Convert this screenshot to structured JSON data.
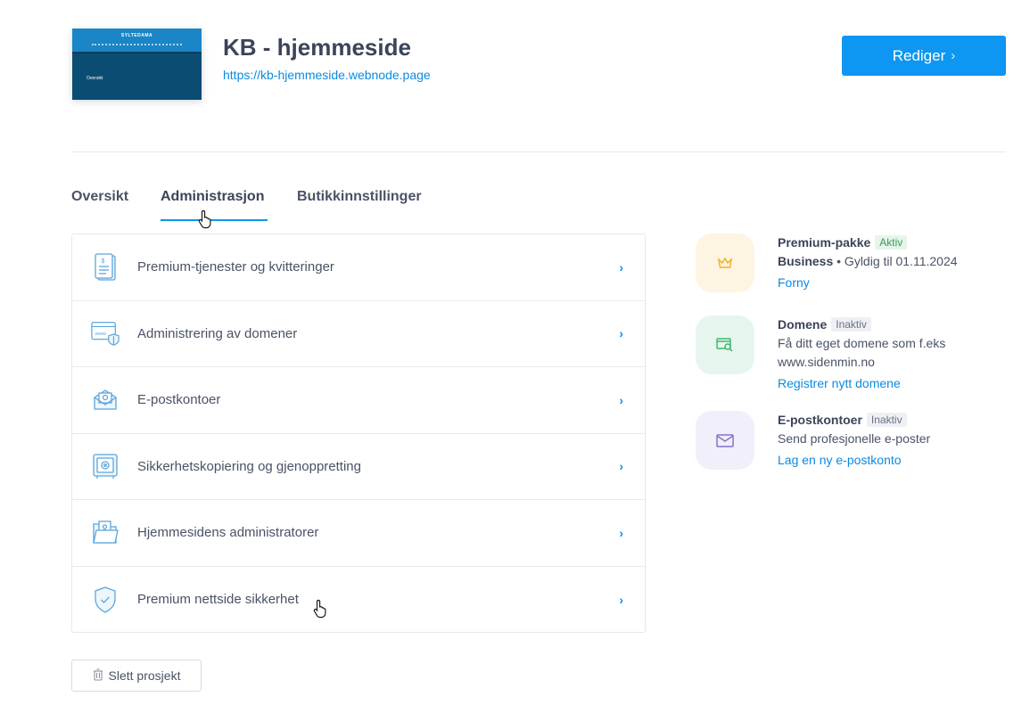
{
  "header": {
    "thumbnail": {
      "brand": "SYLTEDAMA",
      "label": "Oversikt"
    },
    "title": "KB - hjemmeside",
    "url": "https://kb-hjemmeside.webnode.page",
    "edit_label": "Rediger"
  },
  "tabs": [
    {
      "label": "Oversikt"
    },
    {
      "label": "Administrasjon"
    },
    {
      "label": "Butikkinnstillinger"
    }
  ],
  "menu": [
    {
      "label": "Premium-tjenester og kvitteringer",
      "icon": "invoice-icon"
    },
    {
      "label": "Administrering av domener",
      "icon": "domain-icon"
    },
    {
      "label": "E-postkontoer",
      "icon": "email-icon"
    },
    {
      "label": "Sikkerhetskopiering og gjenoppretting",
      "icon": "safe-icon"
    },
    {
      "label": "Hjemmesidens administratorer",
      "icon": "folder-user-icon"
    },
    {
      "label": "Premium nettside sikkerhet",
      "icon": "shield-icon"
    }
  ],
  "info": {
    "premium": {
      "title": "Premium-pakke",
      "status": "Aktiv",
      "plan": "Business",
      "validity": " • Gyldig til 01.11.2024",
      "link": "Forny",
      "icon": "crown-icon",
      "color": "#fdf5e2"
    },
    "domain": {
      "title": "Domene",
      "status": "Inaktiv",
      "text1": "Få ditt eget domene som f.eks",
      "text2": "www.sidenmin.no",
      "link": "Registrer nytt domene",
      "icon": "domain-search-icon",
      "color": "#e6f6ee"
    },
    "email": {
      "title": "E-postkontoer",
      "status": "Inaktiv",
      "text": "Send profesjonelle e-poster",
      "link": "Lag en ny e-postkonto",
      "icon": "envelope-icon",
      "color": "#f1effa"
    }
  },
  "delete_label": "Slett prosjekt",
  "colors": {
    "accent": "#0d97f2",
    "link": "#0b8be0",
    "text": "#3b4459"
  }
}
